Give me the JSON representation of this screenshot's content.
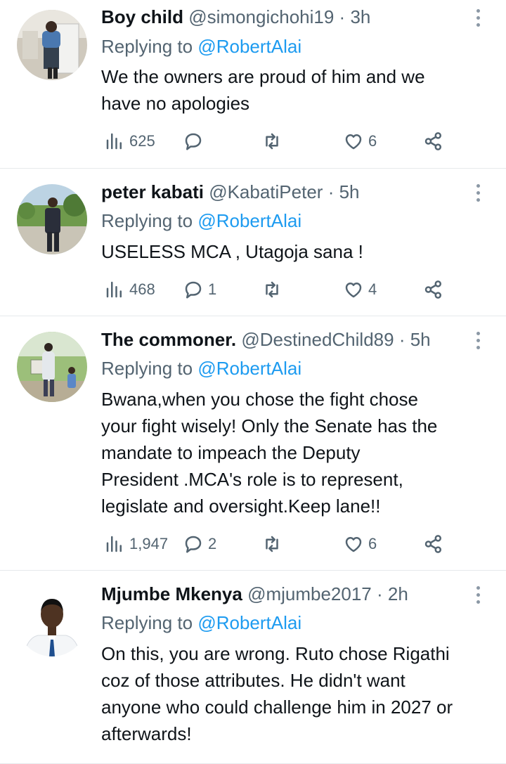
{
  "tweets": [
    {
      "name": "Boy child",
      "handle": "@simongichohi19",
      "sep": "·",
      "time": "3h",
      "replying_prefix": "Replying to",
      "replying_to": "@RobertAlai",
      "lines": [
        "We the owners are proud of him and we",
        "have no apologies"
      ],
      "views": "625",
      "replies": "",
      "retweets": "",
      "likes": "6"
    },
    {
      "name": "peter kabati",
      "handle": "@KabatiPeter",
      "sep": "·",
      "time": "5h",
      "replying_prefix": "Replying to",
      "replying_to": "@RobertAlai",
      "lines": [
        "USELESS MCA , Utagoja sana !"
      ],
      "views": "468",
      "replies": "1",
      "retweets": "",
      "likes": "4"
    },
    {
      "name": "The commoner.",
      "handle": "@DestinedChild89",
      "sep": "·",
      "time": "5h",
      "replying_prefix": "Replying to",
      "replying_to": "@RobertAlai",
      "lines": [
        "Bwana,when you chose the fight chose",
        "your fight wisely! Only the Senate has the",
        "mandate to impeach the Deputy",
        "President .MCA's role is to represent,",
        "legislate and oversight.Keep lane!!"
      ],
      "views": "1,947",
      "replies": "2",
      "retweets": "",
      "likes": "6"
    },
    {
      "name": "Mjumbe Mkenya",
      "handle": "@mjumbe2017",
      "sep": "·",
      "time": "2h",
      "replying_prefix": "Replying to",
      "replying_to": "@RobertAlai",
      "lines": [
        "On this, you are wrong. Ruto chose Rigathi",
        "coz of those attributes. He didn't want",
        "anyone who could challenge him in 2027 or",
        "afterwards!"
      ]
    }
  ],
  "icons": {
    "views": "views-bar-chart-icon",
    "reply": "reply-speech-bubble-icon",
    "retweet": "retweet-arrows-icon",
    "like": "heart-icon",
    "share": "share-nodes-icon",
    "more": "more-vertical-dots-icon"
  },
  "colors": {
    "text": "#0f1419",
    "secondary": "#536471",
    "mention": "#1d9bf0",
    "divider": "#e6e9ec"
  }
}
